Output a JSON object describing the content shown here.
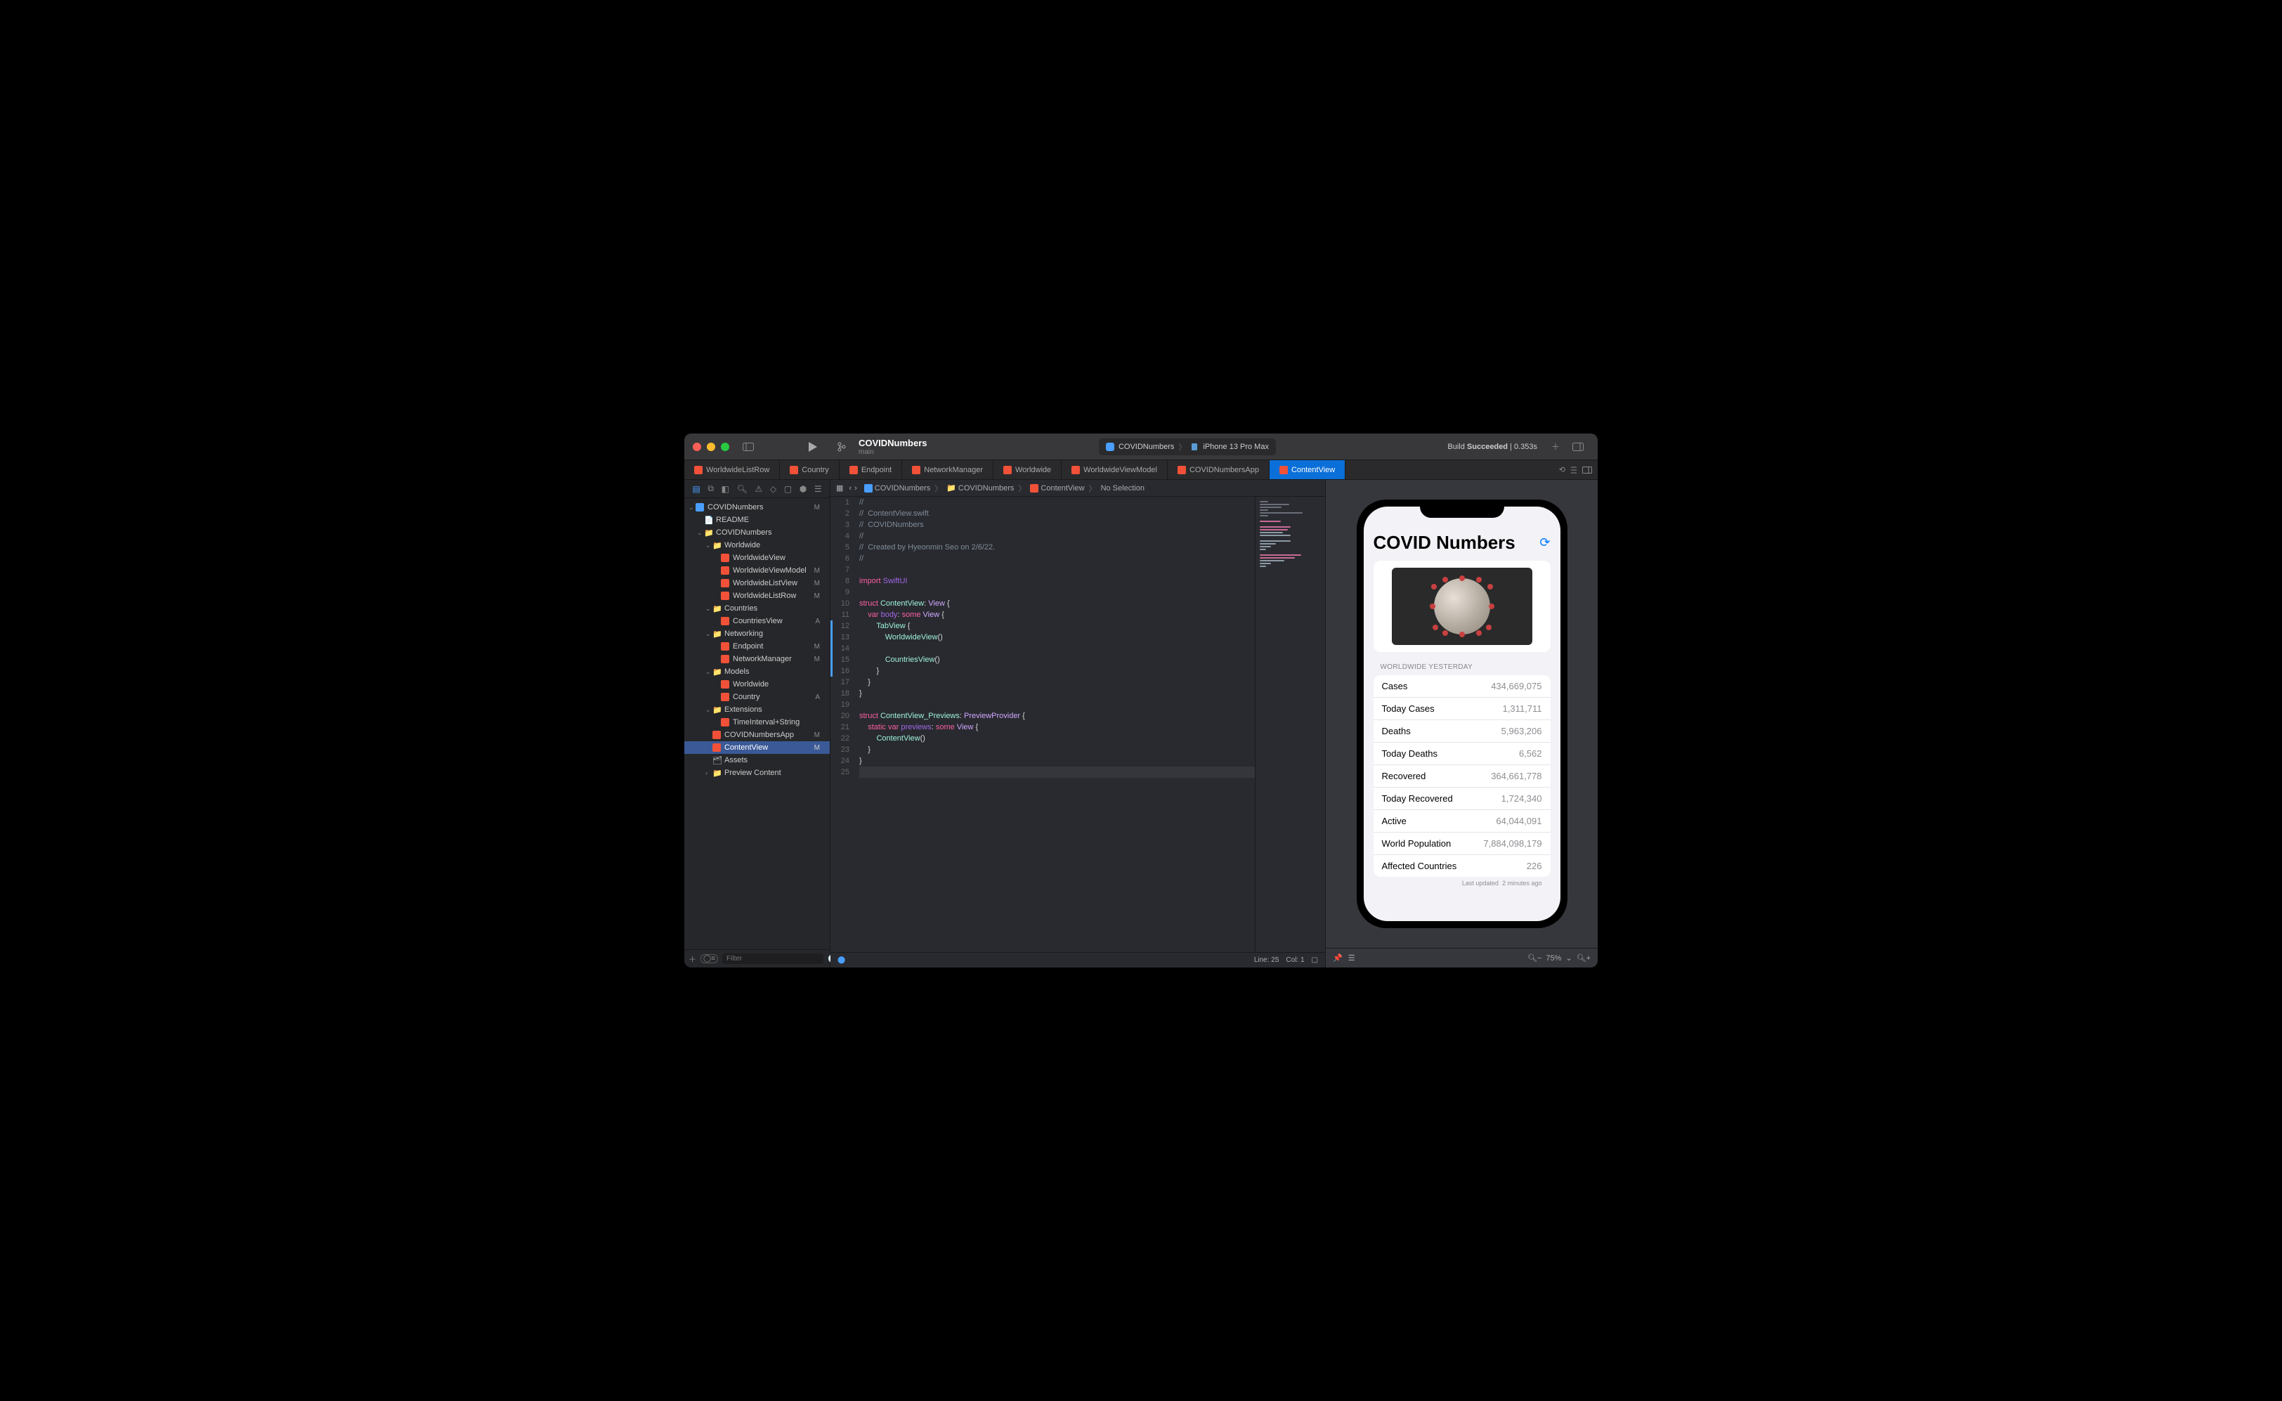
{
  "project": {
    "name": "COVIDNumbers",
    "branch": "main"
  },
  "scheme": {
    "target": "COVIDNumbers",
    "device": "iPhone 13 Pro Max"
  },
  "build": {
    "label": "Build ",
    "status": "Succeeded",
    "suffix": " | 0.353s"
  },
  "tabs": [
    {
      "label": "WorldwideListRow"
    },
    {
      "label": "Country"
    },
    {
      "label": "Endpoint"
    },
    {
      "label": "NetworkManager"
    },
    {
      "label": "Worldwide"
    },
    {
      "label": "WorldwideViewModel"
    },
    {
      "label": "COVIDNumbersApp"
    },
    {
      "label": "ContentView"
    }
  ],
  "jumpbar": {
    "seg0": "COVIDNumbers",
    "seg1": "COVIDNumbers",
    "seg2": "ContentView",
    "seg3": "No Selection"
  },
  "navigator": {
    "root": "COVIDNumbers",
    "readme": "README",
    "folder1": "COVIDNumbers",
    "worldwide": {
      "folder": "Worldwide",
      "items": [
        "WorldwideView",
        "WorldwideViewModel",
        "WorldwideListView",
        "WorldwideListRow"
      ],
      "status": [
        "",
        "M",
        "M",
        "M"
      ]
    },
    "countries": {
      "folder": "Countries",
      "items": [
        "CountriesView"
      ],
      "status": [
        "A"
      ]
    },
    "networking": {
      "folder": "Networking",
      "items": [
        "Endpoint",
        "NetworkManager"
      ],
      "status": [
        "M",
        "M"
      ]
    },
    "models": {
      "folder": "Models",
      "items": [
        "Worldwide",
        "Country"
      ],
      "status": [
        "",
        "A"
      ]
    },
    "extensions": {
      "folder": "Extensions",
      "items": [
        "TimeInterval+String"
      ],
      "status": [
        ""
      ]
    },
    "app": {
      "label": "COVIDNumbersApp",
      "status": "M"
    },
    "contentview": {
      "label": "ContentView",
      "status": "M"
    },
    "assets": "Assets",
    "preview": "Preview Content",
    "root_status": "M",
    "filter_placeholder": "Filter"
  },
  "code": {
    "lines": [
      "//",
      "//  ContentView.swift",
      "//  COVIDNumbers",
      "//",
      "//  Created by Hyeonmin Seo on 2/6/22.",
      "//",
      "",
      "import SwiftUI",
      "",
      "struct ContentView: View {",
      "    var body: some View {",
      "        TabView {",
      "            WorldwideView()",
      "",
      "            CountriesView()",
      "        }",
      "    }",
      "}",
      "",
      "struct ContentView_Previews: PreviewProvider {",
      "    static var previews: some View {",
      "        ContentView()",
      "    }",
      "}",
      ""
    ]
  },
  "editor_footer": {
    "line": "Line: 25",
    "col": "Col: 1"
  },
  "preview": {
    "title": "COVID Numbers",
    "section": "WORLDWIDE YESTERDAY",
    "stats": [
      {
        "label": "Cases",
        "value": "434,669,075"
      },
      {
        "label": "Today Cases",
        "value": "1,311,711"
      },
      {
        "label": "Deaths",
        "value": "5,963,206"
      },
      {
        "label": "Today Deaths",
        "value": "6,562"
      },
      {
        "label": "Recovered",
        "value": "364,661,778"
      },
      {
        "label": "Today Recovered",
        "value": "1,724,340"
      },
      {
        "label": "Active",
        "value": "64,044,091"
      },
      {
        "label": "World Population",
        "value": "7,884,098,179"
      },
      {
        "label": "Affected Countries",
        "value": "226"
      }
    ],
    "updated_label": "Last updated",
    "updated_value": "2 minutes ago",
    "zoom": "75%"
  }
}
